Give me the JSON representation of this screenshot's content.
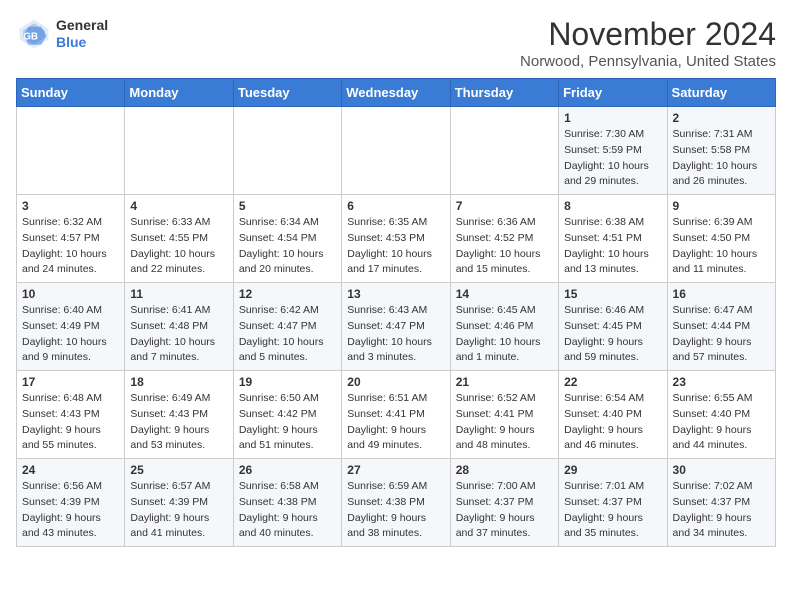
{
  "header": {
    "logo": {
      "general": "General",
      "blue": "Blue"
    },
    "title": "November 2024",
    "location": "Norwood, Pennsylvania, United States"
  },
  "weekdays": [
    "Sunday",
    "Monday",
    "Tuesday",
    "Wednesday",
    "Thursday",
    "Friday",
    "Saturday"
  ],
  "weeks": [
    [
      {
        "day": "",
        "info": ""
      },
      {
        "day": "",
        "info": ""
      },
      {
        "day": "",
        "info": ""
      },
      {
        "day": "",
        "info": ""
      },
      {
        "day": "",
        "info": ""
      },
      {
        "day": "1",
        "info": "Sunrise: 7:30 AM\nSunset: 5:59 PM\nDaylight: 10 hours and 29 minutes."
      },
      {
        "day": "2",
        "info": "Sunrise: 7:31 AM\nSunset: 5:58 PM\nDaylight: 10 hours and 26 minutes."
      }
    ],
    [
      {
        "day": "3",
        "info": "Sunrise: 6:32 AM\nSunset: 4:57 PM\nDaylight: 10 hours and 24 minutes."
      },
      {
        "day": "4",
        "info": "Sunrise: 6:33 AM\nSunset: 4:55 PM\nDaylight: 10 hours and 22 minutes."
      },
      {
        "day": "5",
        "info": "Sunrise: 6:34 AM\nSunset: 4:54 PM\nDaylight: 10 hours and 20 minutes."
      },
      {
        "day": "6",
        "info": "Sunrise: 6:35 AM\nSunset: 4:53 PM\nDaylight: 10 hours and 17 minutes."
      },
      {
        "day": "7",
        "info": "Sunrise: 6:36 AM\nSunset: 4:52 PM\nDaylight: 10 hours and 15 minutes."
      },
      {
        "day": "8",
        "info": "Sunrise: 6:38 AM\nSunset: 4:51 PM\nDaylight: 10 hours and 13 minutes."
      },
      {
        "day": "9",
        "info": "Sunrise: 6:39 AM\nSunset: 4:50 PM\nDaylight: 10 hours and 11 minutes."
      }
    ],
    [
      {
        "day": "10",
        "info": "Sunrise: 6:40 AM\nSunset: 4:49 PM\nDaylight: 10 hours and 9 minutes."
      },
      {
        "day": "11",
        "info": "Sunrise: 6:41 AM\nSunset: 4:48 PM\nDaylight: 10 hours and 7 minutes."
      },
      {
        "day": "12",
        "info": "Sunrise: 6:42 AM\nSunset: 4:47 PM\nDaylight: 10 hours and 5 minutes."
      },
      {
        "day": "13",
        "info": "Sunrise: 6:43 AM\nSunset: 4:47 PM\nDaylight: 10 hours and 3 minutes."
      },
      {
        "day": "14",
        "info": "Sunrise: 6:45 AM\nSunset: 4:46 PM\nDaylight: 10 hours and 1 minute."
      },
      {
        "day": "15",
        "info": "Sunrise: 6:46 AM\nSunset: 4:45 PM\nDaylight: 9 hours and 59 minutes."
      },
      {
        "day": "16",
        "info": "Sunrise: 6:47 AM\nSunset: 4:44 PM\nDaylight: 9 hours and 57 minutes."
      }
    ],
    [
      {
        "day": "17",
        "info": "Sunrise: 6:48 AM\nSunset: 4:43 PM\nDaylight: 9 hours and 55 minutes."
      },
      {
        "day": "18",
        "info": "Sunrise: 6:49 AM\nSunset: 4:43 PM\nDaylight: 9 hours and 53 minutes."
      },
      {
        "day": "19",
        "info": "Sunrise: 6:50 AM\nSunset: 4:42 PM\nDaylight: 9 hours and 51 minutes."
      },
      {
        "day": "20",
        "info": "Sunrise: 6:51 AM\nSunset: 4:41 PM\nDaylight: 9 hours and 49 minutes."
      },
      {
        "day": "21",
        "info": "Sunrise: 6:52 AM\nSunset: 4:41 PM\nDaylight: 9 hours and 48 minutes."
      },
      {
        "day": "22",
        "info": "Sunrise: 6:54 AM\nSunset: 4:40 PM\nDaylight: 9 hours and 46 minutes."
      },
      {
        "day": "23",
        "info": "Sunrise: 6:55 AM\nSunset: 4:40 PM\nDaylight: 9 hours and 44 minutes."
      }
    ],
    [
      {
        "day": "24",
        "info": "Sunrise: 6:56 AM\nSunset: 4:39 PM\nDaylight: 9 hours and 43 minutes."
      },
      {
        "day": "25",
        "info": "Sunrise: 6:57 AM\nSunset: 4:39 PM\nDaylight: 9 hours and 41 minutes."
      },
      {
        "day": "26",
        "info": "Sunrise: 6:58 AM\nSunset: 4:38 PM\nDaylight: 9 hours and 40 minutes."
      },
      {
        "day": "27",
        "info": "Sunrise: 6:59 AM\nSunset: 4:38 PM\nDaylight: 9 hours and 38 minutes."
      },
      {
        "day": "28",
        "info": "Sunrise: 7:00 AM\nSunset: 4:37 PM\nDaylight: 9 hours and 37 minutes."
      },
      {
        "day": "29",
        "info": "Sunrise: 7:01 AM\nSunset: 4:37 PM\nDaylight: 9 hours and 35 minutes."
      },
      {
        "day": "30",
        "info": "Sunrise: 7:02 AM\nSunset: 4:37 PM\nDaylight: 9 hours and 34 minutes."
      }
    ]
  ]
}
